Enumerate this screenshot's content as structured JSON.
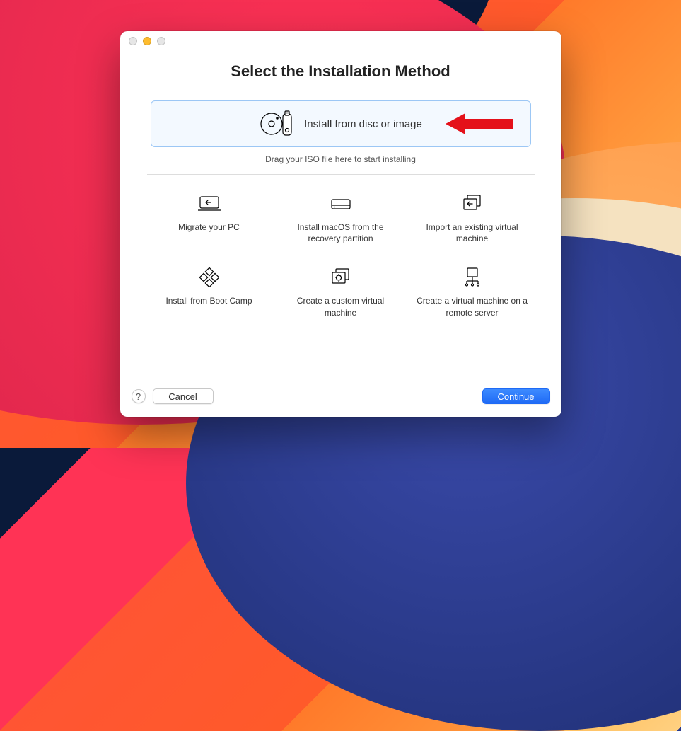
{
  "window": {
    "title": "Select the Installation Method"
  },
  "primary": {
    "label": "Install from disc or image",
    "hint": "Drag your ISO file here to start installing"
  },
  "options": [
    {
      "label": "Migrate your PC"
    },
    {
      "label": "Install macOS from the recovery partition"
    },
    {
      "label": "Import an existing virtual machine"
    },
    {
      "label": "Install from Boot Camp"
    },
    {
      "label": "Create a custom virtual machine"
    },
    {
      "label": "Create a virtual machine on a remote server"
    }
  ],
  "footer": {
    "help": "?",
    "cancel": "Cancel",
    "continue": "Continue"
  }
}
